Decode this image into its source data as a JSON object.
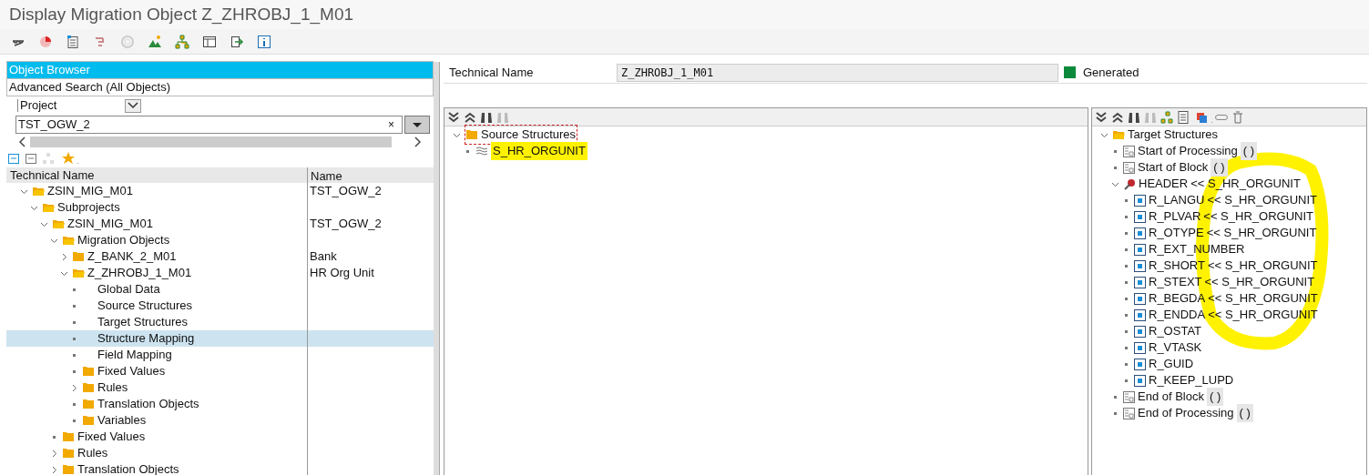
{
  "window": {
    "title": "Display Migration Object Z_ZHROBJ_1_M01"
  },
  "browser": {
    "tabs": [
      {
        "label": "Object Browser",
        "selected": true
      },
      {
        "label": "Advanced Search (All Objects)",
        "selected": false
      }
    ],
    "scope": "Project",
    "field": {
      "value": "TST_OGW_2",
      "clear": "×"
    },
    "columns": [
      "Technical Name",
      "Name"
    ],
    "tree": [
      {
        "label": "ZSIN_MIG_M01",
        "name": "TST_OGW_2",
        "kind": "open_folder",
        "expanded": true,
        "selected": false,
        "children": [
          {
            "label": "Subprojects",
            "kind": "open_folder",
            "expanded": true,
            "selected": false,
            "children": [
              {
                "label": "ZSIN_MIG_M01",
                "name": "TST_OGW_2",
                "kind": "open_folder",
                "expanded": true,
                "selected": false,
                "children": [
                  {
                    "label": "Migration Objects",
                    "kind": "open_folder",
                    "expanded": true,
                    "selected": false,
                    "children": [
                      {
                        "label": "Z_BANK_2_M01",
                        "name": "Bank",
                        "kind": "folder",
                        "expanded": false,
                        "selected": false
                      },
                      {
                        "label": "Z_ZHROBJ_1_M01",
                        "name": "HR Org Unit",
                        "kind": "open_folder",
                        "expanded": true,
                        "selected": false,
                        "children": [
                          {
                            "label": "Global Data",
                            "kind": "item",
                            "selected": false
                          },
                          {
                            "label": "Source Structures",
                            "kind": "item",
                            "selected": false
                          },
                          {
                            "label": "Target Structures",
                            "kind": "item",
                            "selected": false
                          },
                          {
                            "label": "Structure Mapping",
                            "kind": "item",
                            "selected": true
                          },
                          {
                            "label": "Field Mapping",
                            "kind": "item",
                            "selected": false
                          },
                          {
                            "label": "Fixed Values",
                            "kind": "folder",
                            "selected": false
                          },
                          {
                            "label": "Rules",
                            "kind": "folder",
                            "expanded": false,
                            "selected": false
                          },
                          {
                            "label": "Translation Objects",
                            "kind": "folder",
                            "selected": false
                          },
                          {
                            "label": "Variables",
                            "kind": "folder",
                            "selected": false
                          }
                        ]
                      }
                    ]
                  },
                  {
                    "label": "Fixed Values",
                    "kind": "folder",
                    "selected": false
                  },
                  {
                    "label": "Rules",
                    "kind": "folder",
                    "expanded": false,
                    "selected": false
                  },
                  {
                    "label": "Translation Objects",
                    "kind": "folder",
                    "expanded": false,
                    "selected": false
                  }
                ]
              }
            ]
          }
        ]
      }
    ]
  },
  "detail": {
    "label": "Technical Name",
    "value": "Z_ZHROBJ_1_M01",
    "status": "Generated"
  },
  "source_tree": {
    "label": "Source Structures",
    "expanded": true,
    "children": [
      {
        "label": "S_HR_ORGUNIT"
      }
    ]
  },
  "target_tree": {
    "label": "Target Structures",
    "expanded": true,
    "children": [
      {
        "kind": "event",
        "label": "Start of Processing",
        "suffix": "( )"
      },
      {
        "kind": "event",
        "label": "Start of Block",
        "suffix": "( )"
      },
      {
        "kind": "structure",
        "label": "HEADER",
        "mapping": "<< S_HR_ORGUNIT",
        "expanded": true,
        "children": [
          {
            "kind": "field",
            "label": "R_LANGU",
            "mapping": "<< S_HR_ORGUNIT"
          },
          {
            "kind": "field",
            "label": "R_PLVAR",
            "mapping": "<< S_HR_ORGUNIT"
          },
          {
            "kind": "field",
            "label": "R_OTYPE",
            "mapping": "<< S_HR_ORGUNIT"
          },
          {
            "kind": "field",
            "label": "R_EXT_NUMBER"
          },
          {
            "kind": "field",
            "label": "R_SHORT",
            "mapping": "<< S_HR_ORGUNIT"
          },
          {
            "kind": "field",
            "label": "R_STEXT",
            "mapping": "<< S_HR_ORGUNIT"
          },
          {
            "kind": "field",
            "label": "R_BEGDA",
            "mapping": "<< S_HR_ORGUNIT"
          },
          {
            "kind": "field",
            "label": "R_ENDDA",
            "mapping": "<< S_HR_ORGUNIT"
          },
          {
            "kind": "field",
            "label": "R_OSTAT"
          },
          {
            "kind": "field",
            "label": "R_VTASK"
          },
          {
            "kind": "field",
            "label": "R_GUID"
          },
          {
            "kind": "field",
            "label": "R_KEEP_LUPD"
          }
        ]
      },
      {
        "kind": "event",
        "label": "End of Block",
        "suffix": "( )"
      },
      {
        "kind": "event",
        "label": "End of Processing",
        "suffix": "( )"
      }
    ]
  }
}
